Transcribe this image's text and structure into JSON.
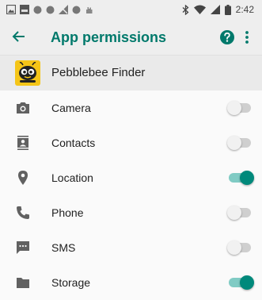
{
  "status_bar": {
    "time": "2:42",
    "left_icons": [
      "gallery-icon",
      "dark-square-icon",
      "circle-icon",
      "circle-icon",
      "signal-slash-icon",
      "circle-icon",
      "hand-icon"
    ],
    "right_icons": [
      "bluetooth-icon",
      "wifi-icon",
      "cell-signal-icon",
      "battery-icon"
    ]
  },
  "app_bar": {
    "title": "App permissions",
    "back_icon": "arrow-back-icon",
    "help_icon": "help-icon",
    "more_icon": "more-vert-icon"
  },
  "app": {
    "name": "Pebblebee Finder",
    "icon": "bee-icon"
  },
  "permissions": [
    {
      "label": "Camera",
      "icon": "camera-icon",
      "enabled": false
    },
    {
      "label": "Contacts",
      "icon": "contacts-icon",
      "enabled": false
    },
    {
      "label": "Location",
      "icon": "location-pin-icon",
      "enabled": true
    },
    {
      "label": "Phone",
      "icon": "phone-icon",
      "enabled": false
    },
    {
      "label": "SMS",
      "icon": "sms-icon",
      "enabled": false
    },
    {
      "label": "Storage",
      "icon": "folder-icon",
      "enabled": true
    }
  ],
  "colors": {
    "accent": "#00796b",
    "toggle_on_thumb": "#00897b",
    "toggle_on_track": "#80cbc4",
    "toggle_off_track": "#cfcfcf",
    "icon_gray": "#616161"
  }
}
